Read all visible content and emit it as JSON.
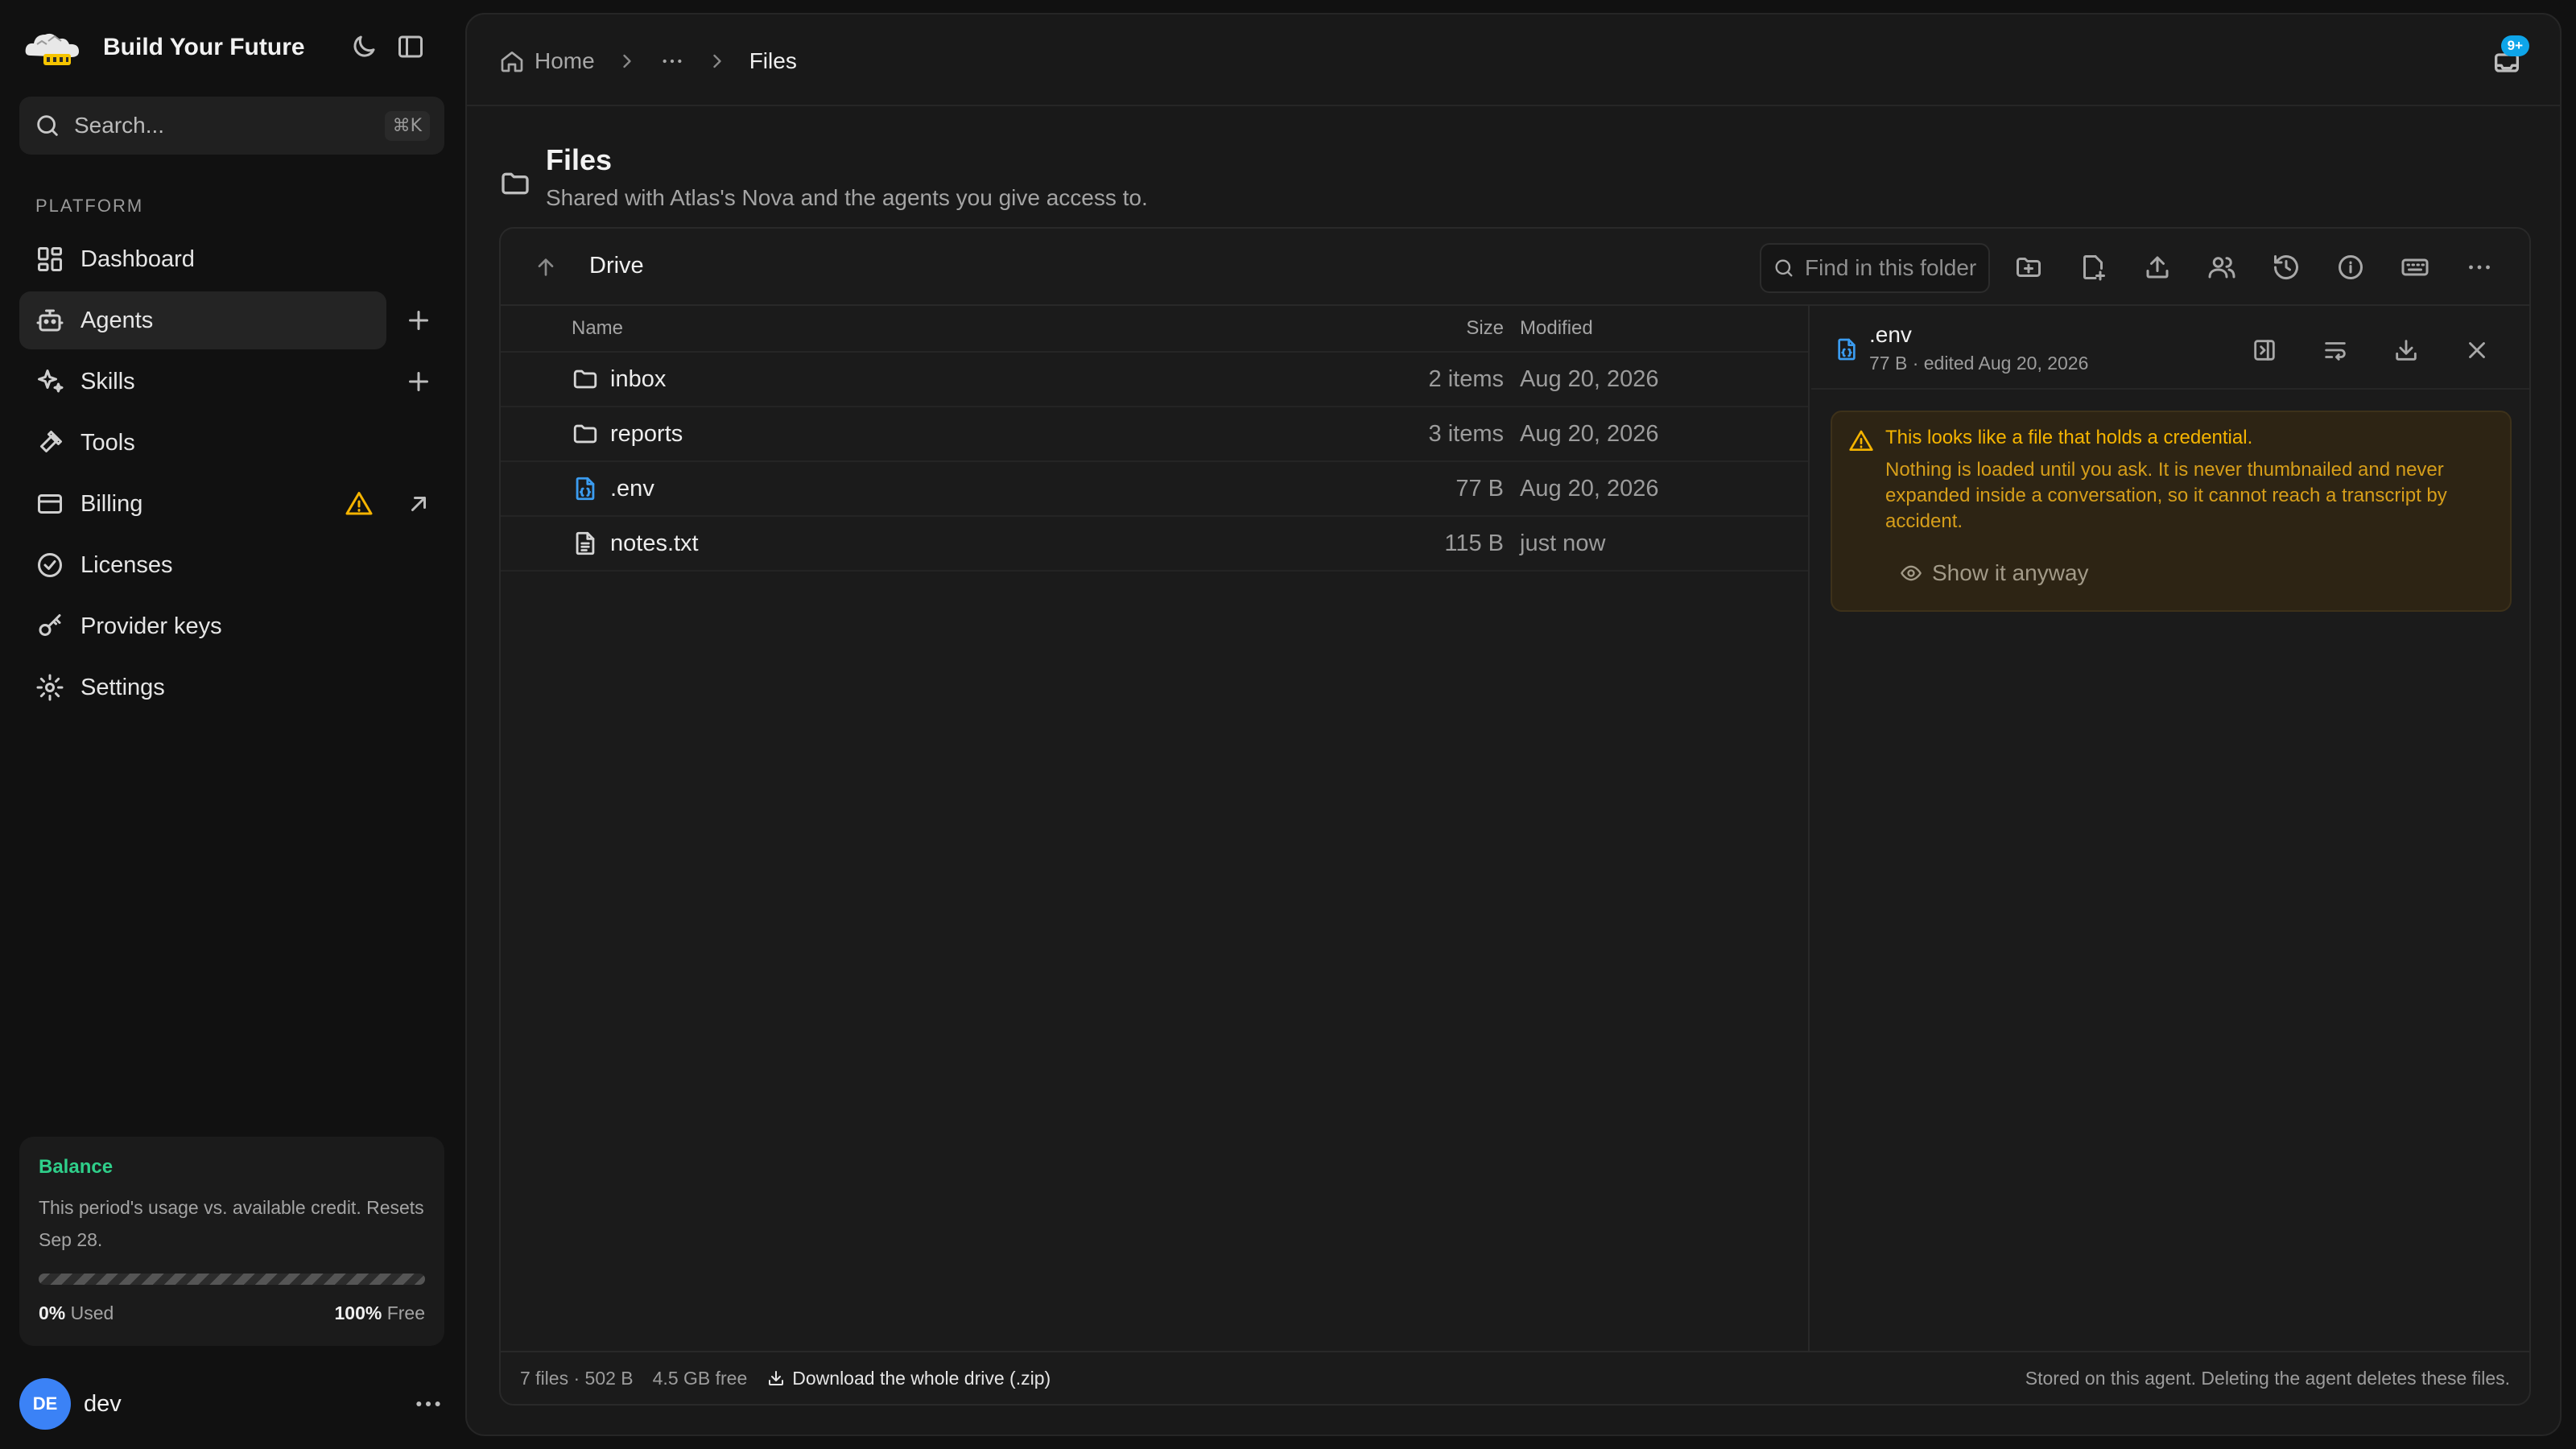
{
  "app": {
    "title": "Build Your Future"
  },
  "search": {
    "placeholder": "Search...",
    "shortcut": "⌘K"
  },
  "sidebar": {
    "section_label": "PLATFORM",
    "items": [
      {
        "label": "Dashboard",
        "icon": "dashboard-icon"
      },
      {
        "label": "Agents",
        "icon": "bot-icon",
        "active": true
      },
      {
        "label": "Skills",
        "icon": "sparkles-icon"
      },
      {
        "label": "Tools",
        "icon": "hammer-icon"
      },
      {
        "label": "Billing",
        "icon": "credit-card-icon"
      },
      {
        "label": "Licenses",
        "icon": "badge-check-icon"
      },
      {
        "label": "Provider keys",
        "icon": "key-icon"
      },
      {
        "label": "Settings",
        "icon": "gear-icon"
      }
    ]
  },
  "balance": {
    "title": "Balance",
    "description": "This period's usage vs. available credit. Resets Sep 28.",
    "used_value": "0%",
    "used_label": "Used",
    "free_value": "100%",
    "free_label": "Free"
  },
  "user": {
    "initials": "DE",
    "name": "dev"
  },
  "breadcrumb": {
    "home": "Home",
    "current": "Files"
  },
  "notifications": {
    "badge": "9+"
  },
  "page": {
    "title": "Files",
    "subtitle": "Shared with Atlas's Nova and the agents you give access to."
  },
  "drive": {
    "title": "Drive",
    "find_placeholder": "Find in this folder",
    "columns": {
      "name": "Name",
      "size": "Size",
      "modified": "Modified"
    },
    "rows": [
      {
        "name": "inbox",
        "type": "folder",
        "size": "2 items",
        "modified": "Aug 20, 2026"
      },
      {
        "name": "reports",
        "type": "folder",
        "size": "3 items",
        "modified": "Aug 20, 2026"
      },
      {
        "name": ".env",
        "type": "env-file",
        "size": "77 B",
        "modified": "Aug 20, 2026"
      },
      {
        "name": "notes.txt",
        "type": "text-file",
        "size": "115 B",
        "modified": "just now"
      }
    ]
  },
  "preview": {
    "name": ".env",
    "meta": "77 B · edited Aug 20, 2026",
    "warning_title": "This looks like a file that holds a credential.",
    "warning_body": "Nothing is loaded until you ask. It is never thumbnailed and never expanded inside a conversation, so it cannot reach a transcript by accident.",
    "show_button": "Show it anyway"
  },
  "footer": {
    "count": "7 files · 502 B",
    "free": "4.5 GB free",
    "download": "Download the whole drive (.zip)",
    "note": "Stored on this agent. Deleting the agent deletes these files."
  },
  "colors": {
    "accent_green": "#2fcf8a",
    "warning": "#f5b400",
    "badge": "#0ea5e9",
    "avatar": "#3b82f6",
    "file_blue": "#3b9cf0"
  }
}
